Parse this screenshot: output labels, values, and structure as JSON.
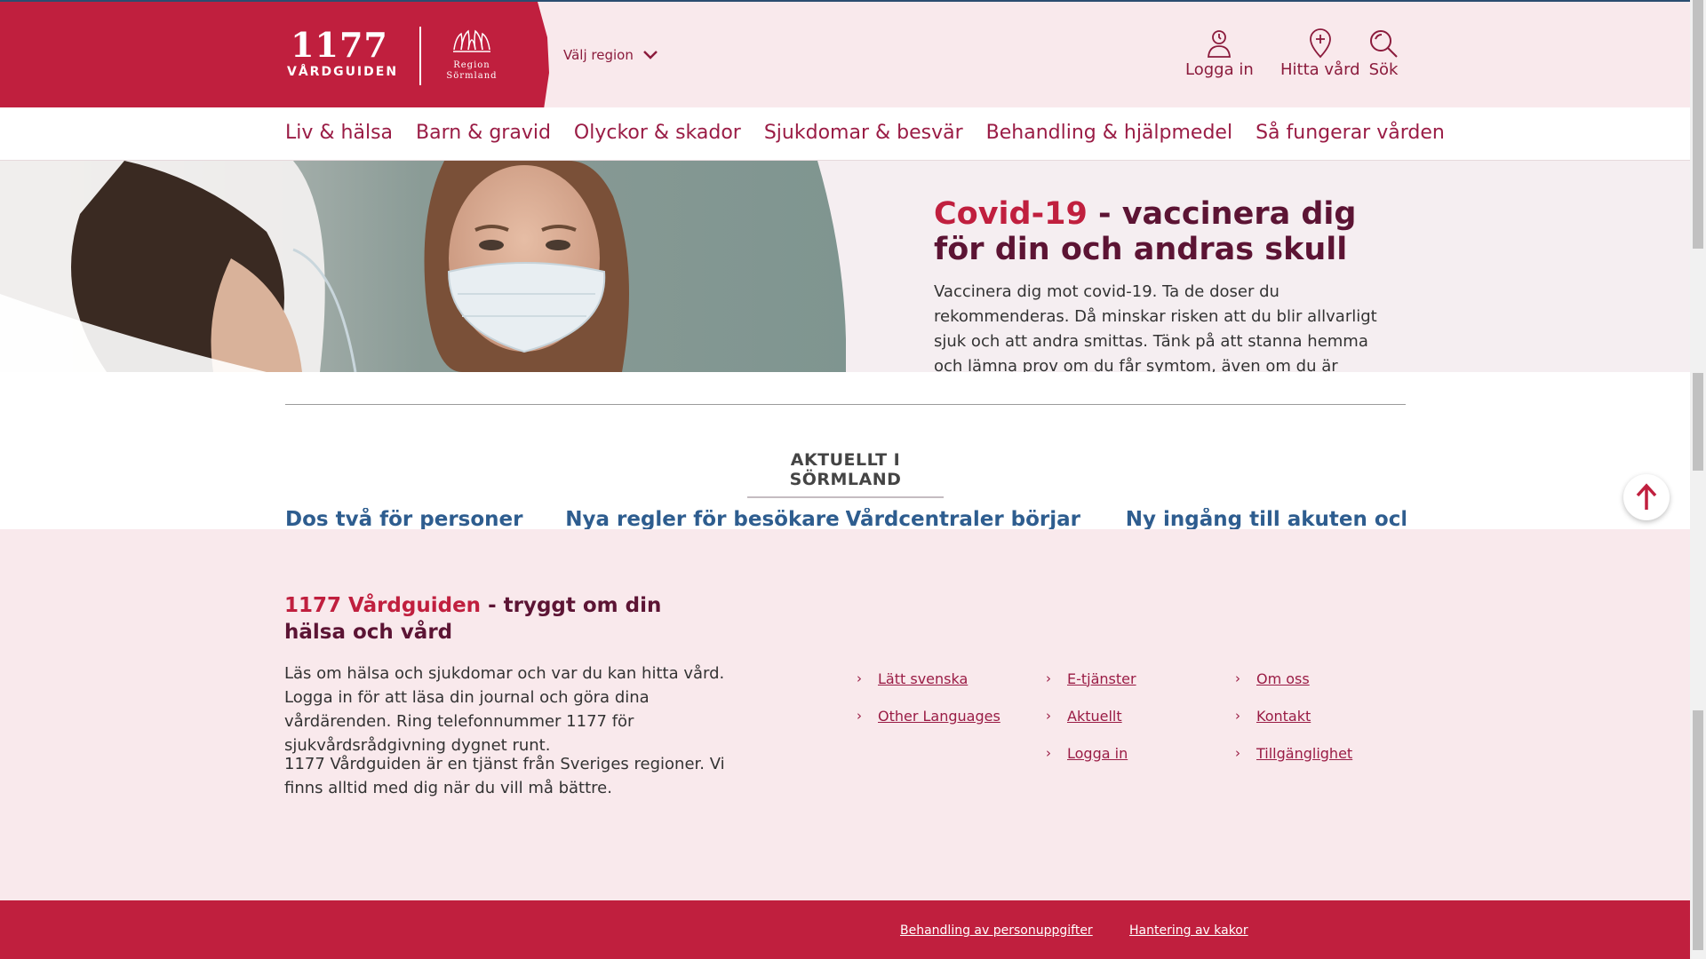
{
  "header": {
    "logo_number": "1177",
    "logo_name": "VÅRDGUIDEN",
    "region_logo_name": "Region Sörmland",
    "region_select_label": "Välj region",
    "utilities": [
      {
        "label": "Logga in",
        "icon": "person-icon"
      },
      {
        "label": "Hitta vård",
        "icon": "map-pin-plus-icon"
      },
      {
        "label": "Sök",
        "icon": "search-icon"
      }
    ]
  },
  "nav": {
    "items": [
      "Liv & hälsa",
      "Barn & gravid",
      "Olyckor & skador",
      "Sjukdomar & besvär",
      "Behandling & hjälpmedel",
      "Så fungerar vården"
    ]
  },
  "hero": {
    "title_accent": "Covid-19",
    "title_rest": " - vaccinera dig för din och andras skull",
    "text": "Vaccinera dig mot covid-19. Ta de doser du rekommenderas. Då minskar risken att du blir allvarligt sjuk och att andra smittas. Tänk på att stanna hemma och lämna prov om du får symtom, även om du är vaccinerad."
  },
  "aktuellt": {
    "heading": "AKTUELLT I SÖRMLAND",
    "items": [
      "Dos två för personer",
      "Nya regler för besökare",
      "Vårdcentraler börjar",
      "Ny ingång till akuten och"
    ]
  },
  "footer": {
    "title_accent": "1177 Vårdguiden",
    "title_rest": " - tryggt om din hälsa och vård",
    "paragraph1": "Läs om hälsa och sjukdomar och var du kan hitta vård. Logga in för att läsa din journal och göra dina vårdärenden. Ring telefonnummer 1177 för sjukvårdsrådgivning dygnet runt.",
    "paragraph2": "1177 Vårdguiden är en tjänst från Sveriges regioner. Vi finns alltid med dig när du vill må bättre.",
    "links_col1": [
      "Lätt svenska",
      "Other Languages"
    ],
    "links_col2": [
      "E-tjänster",
      "Aktuellt",
      "Logga in"
    ],
    "links_col3": [
      "Om oss",
      "Kontakt",
      "Tillgänglighet"
    ]
  },
  "bottom_bar": {
    "links": [
      "Behandling av personuppgifter",
      "Hantering av kakor"
    ]
  },
  "colors": {
    "brand_red": "#c01f3e",
    "dark_burgundy": "#5c1434",
    "link_burgundy": "#9a1c45",
    "news_blue": "#2e5d8f",
    "light_pink": "#f9e9ec"
  }
}
